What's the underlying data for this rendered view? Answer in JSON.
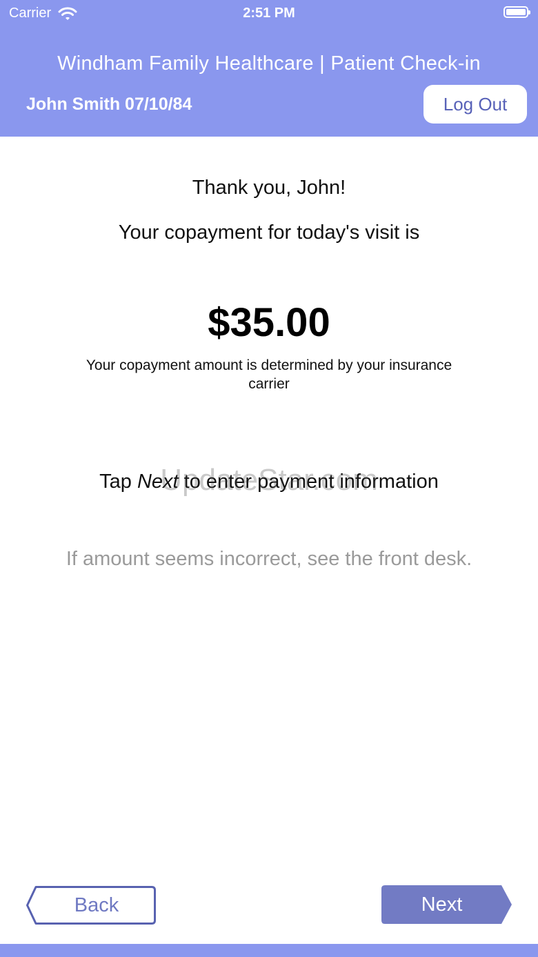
{
  "status_bar": {
    "carrier": "Carrier",
    "time": "2:51 PM"
  },
  "header": {
    "title": "Windham Family Healthcare | Patient Check-in",
    "patient": "John Smith 07/10/84",
    "logout_label": "Log Out"
  },
  "main": {
    "thank_you": "Thank you, John!",
    "copay_intro": "Your copayment for today's visit is",
    "amount": "$35.00",
    "copay_note": "Your copayment amount is determined by your insurance carrier",
    "tap_prefix": "Tap ",
    "tap_emphasis": "Next",
    "tap_suffix": " to enter payment information",
    "incorrect_note": "If amount seems incorrect, see the front desk."
  },
  "watermark": "UpdateStar.com",
  "nav": {
    "back_label": "Back",
    "next_label": "Next"
  },
  "colors": {
    "header_bg": "#8a97ee",
    "next_bg": "#727bc4",
    "back_border": "#5862b0",
    "muted_text": "#9a9a9a"
  }
}
